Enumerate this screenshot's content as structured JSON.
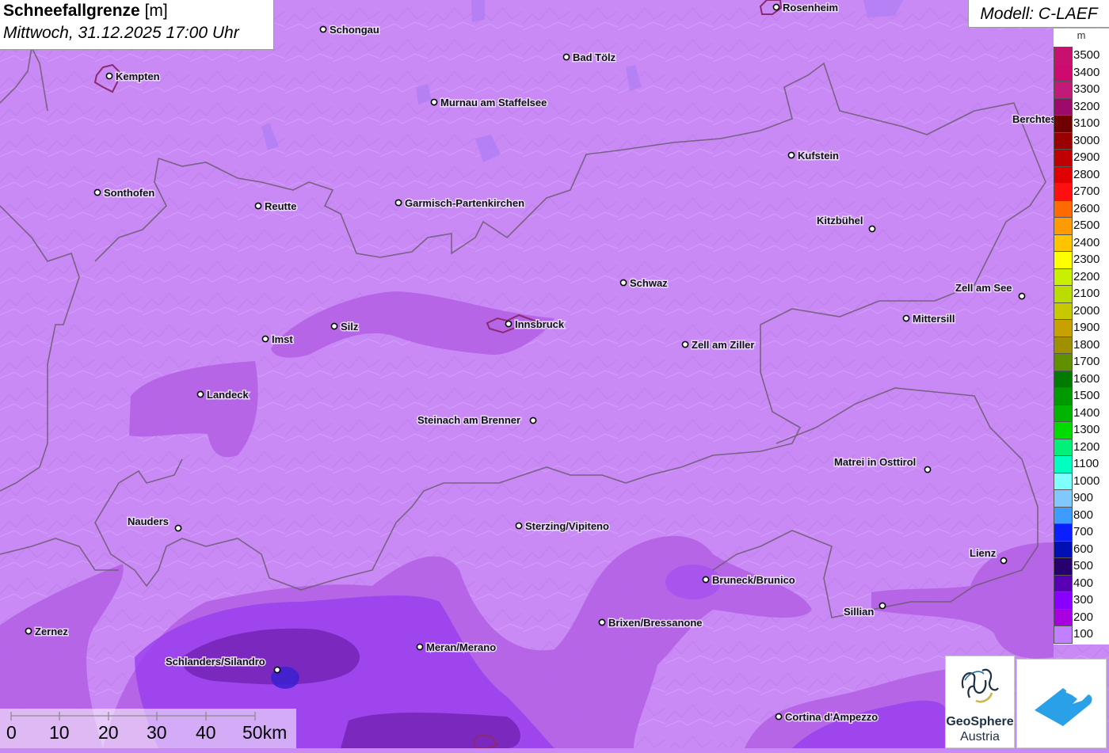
{
  "header": {
    "title": "Schneefallgrenze",
    "unit": "[m]",
    "subtitle": "Mittwoch, 31.12.2025 17:00 Uhr"
  },
  "model": "Modell: C-LAEF",
  "legend": {
    "unit": "m",
    "items": [
      {
        "value": "3500",
        "color": "#c8106e"
      },
      {
        "value": "3400",
        "color": "#cf0a6f"
      },
      {
        "value": "3300",
        "color": "#c21a78"
      },
      {
        "value": "3200",
        "color": "#9e0a6b"
      },
      {
        "value": "3100",
        "color": "#6e0000"
      },
      {
        "value": "3000",
        "color": "#9a0000"
      },
      {
        "value": "2900",
        "color": "#c00000"
      },
      {
        "value": "2800",
        "color": "#e00000"
      },
      {
        "value": "2700",
        "color": "#ff1010"
      },
      {
        "value": "2600",
        "color": "#ff6a00"
      },
      {
        "value": "2500",
        "color": "#ff9a00"
      },
      {
        "value": "2400",
        "color": "#ffc400"
      },
      {
        "value": "2300",
        "color": "#ffff00"
      },
      {
        "value": "2200",
        "color": "#c8f000"
      },
      {
        "value": "2100",
        "color": "#bcdc00"
      },
      {
        "value": "2000",
        "color": "#c8c800"
      },
      {
        "value": "1900",
        "color": "#c8a000"
      },
      {
        "value": "1800",
        "color": "#a09000"
      },
      {
        "value": "1700",
        "color": "#609000"
      },
      {
        "value": "1600",
        "color": "#007a00"
      },
      {
        "value": "1500",
        "color": "#009a00"
      },
      {
        "value": "1400",
        "color": "#00b400"
      },
      {
        "value": "1300",
        "color": "#00dc00"
      },
      {
        "value": "1200",
        "color": "#00f07a"
      },
      {
        "value": "1100",
        "color": "#00ffc0"
      },
      {
        "value": "1000",
        "color": "#80ffff"
      },
      {
        "value": "900",
        "color": "#80c8ff"
      },
      {
        "value": "800",
        "color": "#3c9cff"
      },
      {
        "value": "700",
        "color": "#0a1eff"
      },
      {
        "value": "600",
        "color": "#0010b4"
      },
      {
        "value": "500",
        "color": "#28006e"
      },
      {
        "value": "400",
        "color": "#5a00b4"
      },
      {
        "value": "300",
        "color": "#8a00ff"
      },
      {
        "value": "200",
        "color": "#a800e0"
      },
      {
        "value": "100",
        "color": "#c080ff"
      }
    ]
  },
  "cities": [
    {
      "name": "Rosenheim"
    },
    {
      "name": "Schongau"
    },
    {
      "name": "Bad Tölz"
    },
    {
      "name": "Kempten"
    },
    {
      "name": "Murnau am Staffelsee"
    },
    {
      "name": "Berchtes"
    },
    {
      "name": "Kufstein"
    },
    {
      "name": "Sonthofen"
    },
    {
      "name": "Reutte"
    },
    {
      "name": "Garmisch-Partenkirchen"
    },
    {
      "name": "Kitzbühel"
    },
    {
      "name": "Schwaz"
    },
    {
      "name": "Zell am See"
    },
    {
      "name": "Mittersill"
    },
    {
      "name": "Innsbruck"
    },
    {
      "name": "Silz"
    },
    {
      "name": "Imst"
    },
    {
      "name": "Zell am Ziller"
    },
    {
      "name": "Landeck"
    },
    {
      "name": "Steinach am Brenner"
    },
    {
      "name": "Matrei in Osttirol"
    },
    {
      "name": "Nauders"
    },
    {
      "name": "Sterzing/Vipiteno"
    },
    {
      "name": "Lienz"
    },
    {
      "name": "Bruneck/Brunico"
    },
    {
      "name": "Sillian"
    },
    {
      "name": "Brixen/Bressanone"
    },
    {
      "name": "Zernez"
    },
    {
      "name": "Meran/Merano"
    },
    {
      "name": "Schlanders/Silandro"
    },
    {
      "name": "Cortina d'Ampezzo"
    }
  ],
  "scalebar": {
    "labels": [
      "0",
      "10",
      "20",
      "30",
      "40",
      "50km"
    ]
  },
  "logos": {
    "geosphere_title": "GeoSphere",
    "geosphere_sub": "Austria"
  }
}
